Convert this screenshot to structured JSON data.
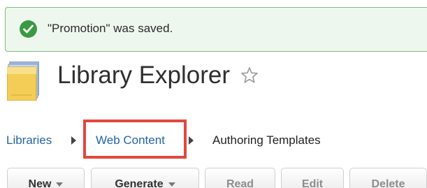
{
  "alert": {
    "message": "\"Promotion\" was saved.",
    "icon": "check-circle-icon",
    "status_color": "#3a9a42"
  },
  "header": {
    "title": "Library Explorer",
    "icon": "library-explorer-icon",
    "favorite_icon": "star-outline-icon"
  },
  "breadcrumb": {
    "items": [
      {
        "label": "Libraries"
      },
      {
        "label": "Web Content"
      },
      {
        "label": "Authoring Templates"
      }
    ],
    "highlight_color": "#e2473f"
  },
  "toolbar": {
    "buttons": [
      {
        "label": "New"
      },
      {
        "label": "Generate"
      },
      {
        "label": "Read"
      },
      {
        "label": "Edit"
      },
      {
        "label": "Delete"
      }
    ]
  }
}
